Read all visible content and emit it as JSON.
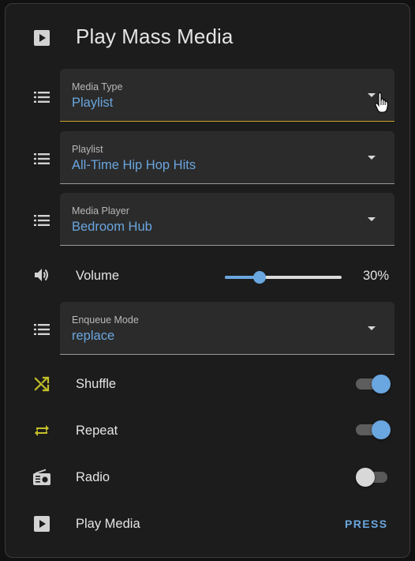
{
  "header": {
    "title": "Play Mass Media",
    "icon": "play-box-icon"
  },
  "fields": {
    "media_type": {
      "label": "Media Type",
      "value": "Playlist",
      "icon": "list-icon"
    },
    "playlist": {
      "label": "Playlist",
      "value": "All-Time Hip Hop Hits",
      "icon": "list-icon"
    },
    "media_player": {
      "label": "Media Player",
      "value": "Bedroom Hub",
      "icon": "list-icon"
    },
    "enqueue_mode": {
      "label": "Enqueue Mode",
      "value": "replace",
      "icon": "list-icon"
    }
  },
  "volume": {
    "label": "Volume",
    "value_text": "30%",
    "value": 0.3,
    "icon": "volume-high-icon"
  },
  "toggles": {
    "shuffle": {
      "label": "Shuffle",
      "state": true,
      "icon": "shuffle-icon"
    },
    "repeat": {
      "label": "Repeat",
      "state": true,
      "icon": "repeat-icon"
    },
    "radio": {
      "label": "Radio",
      "state": false,
      "icon": "radio-icon"
    }
  },
  "play_media": {
    "label": "Play Media",
    "button_label": "PRESS",
    "icon": "play-box-icon"
  },
  "colors": {
    "accent": "#6aa6df",
    "focus_underline": "#c9a227",
    "icon_yellow": "#c3c02a",
    "card_bg": "#1c1c1c",
    "field_bg": "#2b2b2b"
  }
}
